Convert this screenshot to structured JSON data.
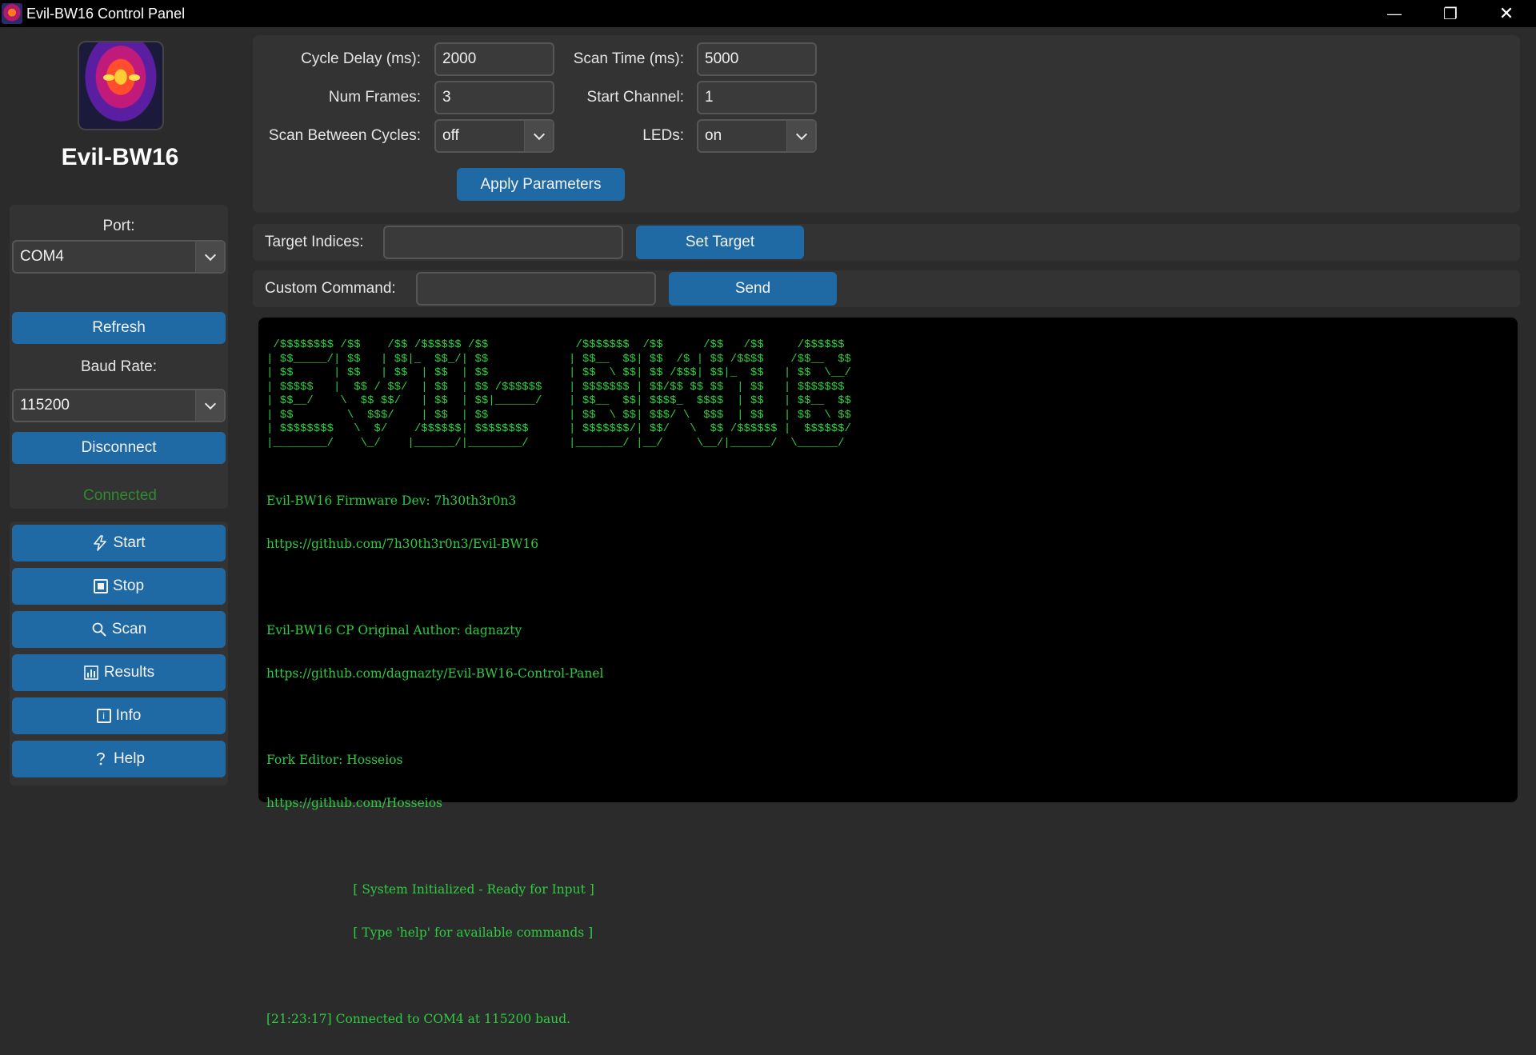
{
  "window": {
    "title": "Evil-BW16 Control Panel",
    "minimize": "—",
    "maximize": "❐",
    "close": "✕"
  },
  "sidebar": {
    "app_name": "Evil-BW16",
    "port_label": "Port:",
    "port_value": "COM4",
    "refresh_label": "Refresh",
    "baud_label": "Baud Rate:",
    "baud_value": "115200",
    "disconnect_label": "Disconnect",
    "status": "Connected",
    "status_color": "#2e8b2e",
    "menu": [
      {
        "label": "Start",
        "icon": "lightning-icon"
      },
      {
        "label": "Stop",
        "icon": "stop-icon"
      },
      {
        "label": "Scan",
        "icon": "search-icon"
      },
      {
        "label": "Results",
        "icon": "bar-chart-icon"
      },
      {
        "label": "Info",
        "icon": "info-icon"
      },
      {
        "label": "Help",
        "icon": "help-icon"
      }
    ]
  },
  "params": {
    "cycle_delay_label": "Cycle Delay (ms):",
    "cycle_delay_value": "2000",
    "scan_time_label": "Scan Time (ms):",
    "scan_time_value": "5000",
    "num_frames_label": "Num Frames:",
    "num_frames_value": "3",
    "start_channel_label": "Start Channel:",
    "start_channel_value": "1",
    "scan_between_label": "Scan Between Cycles:",
    "scan_between_value": "off",
    "leds_label": "LEDs:",
    "leds_value": "on",
    "apply_label": "Apply Parameters"
  },
  "target": {
    "label": "Target Indices:",
    "value": "",
    "button": "Set Target"
  },
  "custom": {
    "label": "Custom Command:",
    "value": "",
    "button": "Send"
  },
  "console": {
    "ascii_banner": " /$$$$$$$$ /$$    /$$ /$$$$$$ /$$             /$$$$$$$  /$$      /$$   /$$     /$$$$$$ \n| $$_____/| $$   | $$|_  $$_/| $$            | $$__  $$| $$  /$ | $$ /$$$$    /$$__  $$\n| $$      | $$   | $$  | $$  | $$            | $$  \\ $$| $$ /$$$| $$|_  $$   | $$  \\__/\n| $$$$$   |  $$ / $$/  | $$  | $$ /$$$$$$    | $$$$$$$ | $$/$$ $$ $$  | $$   | $$$$$$$ \n| $$__/    \\  $$ $$/   | $$  | $$|______/    | $$__  $$| $$$$_  $$$$  | $$   | $$__  $$\n| $$        \\  $$$/    | $$  | $$            | $$  \\ $$| $$$/ \\  $$$  | $$   | $$  \\ $$\n| $$$$$$$$   \\  $/    /$$$$$$| $$$$$$$$      | $$$$$$$/| $$/   \\  $$ /$$$$$$ |  $$$$$$/\n|________/    \\_/    |______/|________/      |_______/ |__/     \\__/|______/  \\______/ ",
    "lines": [
      "Evil-BW16 Firmware Dev: 7h30th3r0n3",
      "https://github.com/7h30th3r0n3/Evil-BW16",
      "",
      "Evil-BW16 CP Original Author: dagnazty",
      "https://github.com/dagnazty/Evil-BW16-Control-Panel",
      "",
      "Fork Editor: Hosseios",
      "https://github.com/Hosseios",
      "",
      "                      [ System Initialized - Ready for Input ]",
      "                      [ Type 'help' for available commands ]",
      "",
      "[21:23:17] Connected to COM4 at 115200 baud."
    ],
    "text_color": "#2ecc40"
  }
}
